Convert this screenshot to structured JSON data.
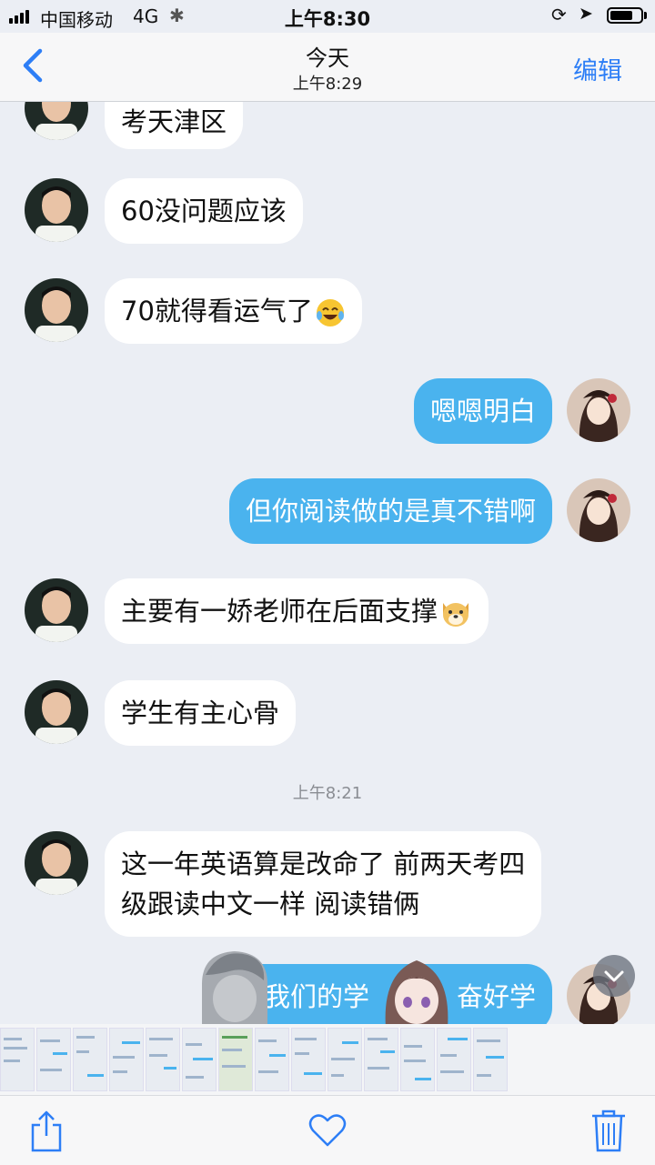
{
  "status": {
    "carrier": "中国移动",
    "network": "4G",
    "time": "上午8:30",
    "battery_level": 0.75
  },
  "nav": {
    "title": "今天",
    "subtitle": "上午8:29",
    "edit_label": "编辑"
  },
  "messages": [
    {
      "side": "left",
      "text": "考天津区"
    },
    {
      "side": "left",
      "text": "60没问题应该"
    },
    {
      "side": "left",
      "text": "70就得看运气了",
      "emoji": "laughing-tears-emoji"
    },
    {
      "side": "right",
      "text": "嗯嗯明白"
    },
    {
      "side": "right",
      "text": "但你阅读做的是真不错啊"
    },
    {
      "side": "left",
      "text": "主要有一娇老师在后面支撑",
      "emoji": "dog-face-emoji"
    },
    {
      "side": "left",
      "text": "学生有主心骨"
    },
    {
      "timestamp": "上午8:21"
    },
    {
      "side": "left",
      "line1": "这一年英语算是改命了 前两天考四",
      "line2": "级跟读中文一样 阅读错俩"
    },
    {
      "side": "right",
      "text": "是我们的学",
      "text_tail": "奋好学",
      "partial": true
    }
  ],
  "toolbar": {
    "share_icon": "share-icon",
    "like_icon": "heart-icon",
    "delete_icon": "trash-icon"
  },
  "colors": {
    "accent": "#2d7ef6",
    "outgoing_bubble": "#4ab3ee",
    "background": "#ebeef4"
  }
}
